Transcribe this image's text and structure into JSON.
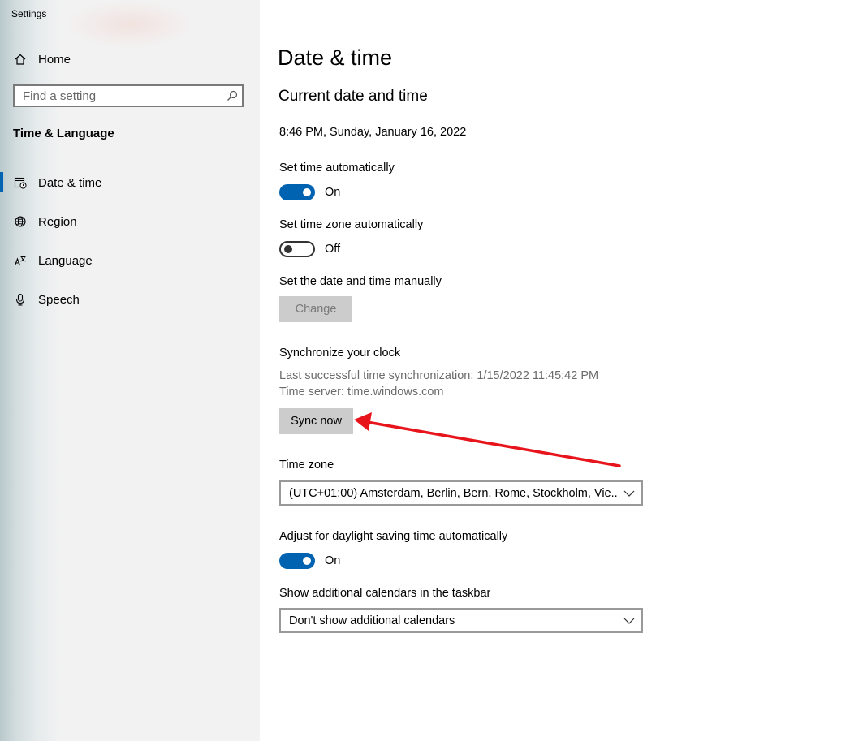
{
  "window": {
    "title": "Settings"
  },
  "sidebar": {
    "home_label": "Home",
    "search_placeholder": "Find a setting",
    "section_title": "Time & Language",
    "items": [
      {
        "label": "Date & time",
        "icon": "calendar-clock-icon",
        "active": true
      },
      {
        "label": "Region",
        "icon": "globe-icon",
        "active": false
      },
      {
        "label": "Language",
        "icon": "language-icon",
        "active": false
      },
      {
        "label": "Speech",
        "icon": "microphone-icon",
        "active": false
      }
    ]
  },
  "main": {
    "page_title": "Date & time",
    "section_title": "Current date and time",
    "current_datetime": "8:46 PM, Sunday, January 16, 2022",
    "set_time_auto": {
      "label": "Set time automatically",
      "state": "On",
      "on": true
    },
    "set_tz_auto": {
      "label": "Set time zone automatically",
      "state": "Off",
      "on": false
    },
    "manual": {
      "label": "Set the date and time manually",
      "button": "Change",
      "disabled": true
    },
    "sync": {
      "title": "Synchronize your clock",
      "last_sync": "Last successful time synchronization: 1/15/2022 11:45:42 PM",
      "server": "Time server: time.windows.com",
      "button": "Sync now"
    },
    "timezone": {
      "label": "Time zone",
      "value": "(UTC+01:00) Amsterdam, Berlin, Bern, Rome, Stockholm, Vie..."
    },
    "daylight": {
      "label": "Adjust for daylight saving time automatically",
      "state": "On",
      "on": true
    },
    "calendars": {
      "label": "Show additional calendars in the taskbar",
      "value": "Don't show additional calendars"
    }
  },
  "colors": {
    "accent": "#0063b1",
    "annotation_arrow": "#e8141b",
    "sidebar_bg": "#f2f2f2"
  }
}
